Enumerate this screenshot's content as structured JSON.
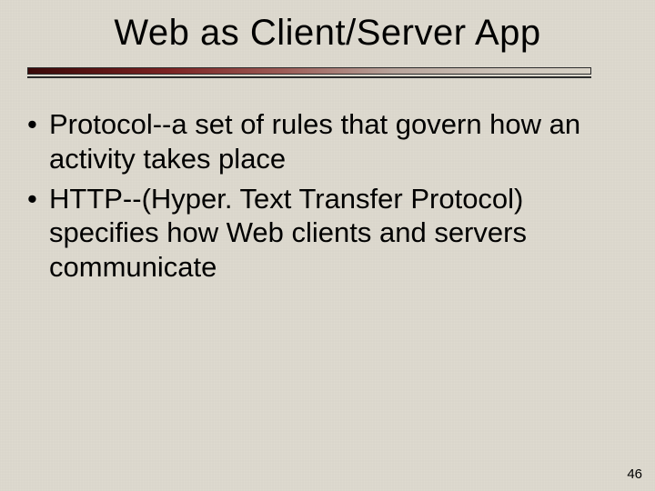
{
  "slide": {
    "title": "Web as Client/Server App",
    "bullets": [
      "Protocol--a set of rules that govern how an activity takes place",
      "HTTP--(Hyper. Text Transfer Protocol) specifies how Web clients and servers communicate"
    ],
    "page_number": "46"
  },
  "colors": {
    "background": "#dcd8cd",
    "rule_gradient_start": "#3a0a0a",
    "rule_gradient_end": "#d8d2c6",
    "rule_border": "#2b2b2b"
  }
}
